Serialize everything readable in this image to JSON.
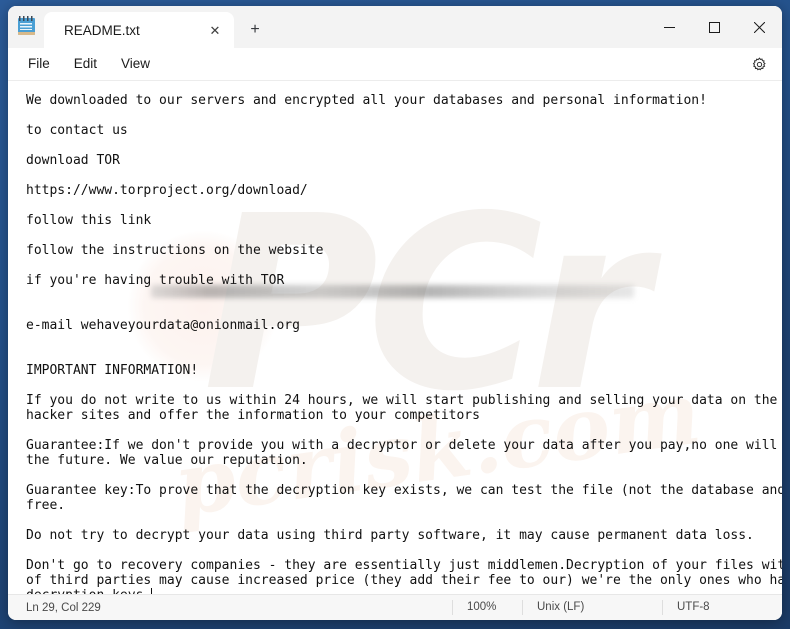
{
  "window": {
    "app_icon": "notepad-icon",
    "controls": {
      "minimize": "minimize-icon",
      "maximize": "maximize-icon",
      "close": "close-icon"
    }
  },
  "tabs": [
    {
      "title": "README.txt",
      "close_label": "✕",
      "active": true
    }
  ],
  "new_tab_label": "+",
  "menu": {
    "items": [
      "File",
      "Edit",
      "View"
    ],
    "settings_label": "settings-gear-icon"
  },
  "watermark": {
    "big": "PCr",
    "small": "pcrisk.com"
  },
  "editor": {
    "redacted_line_note": "blurred-url-redaction",
    "caret_visible": true,
    "lines": [
      "We downloaded to our servers and encrypted all your databases and personal information!",
      "",
      "to contact us",
      "",
      "download TOR",
      "",
      "https://www.torproject.org/download/",
      "",
      "follow this link ",
      "",
      "follow the instructions on the website",
      "",
      "if you're having trouble with TOR",
      "",
      "",
      "e-mail wehaveyourdata@onionmail.org",
      "",
      "",
      "IMPORTANT INFORMATION!",
      "",
      "If you do not write to us within 24 hours, we will start publishing and selling your data on the darknet on",
      "hacker sites and offer the information to your competitors",
      "",
      "Guarantee:If we don't provide you with a decryptor or delete your data after you pay,no one will pay us in",
      "the future. We value our reputation.",
      "",
      "Guarantee key:To prove that the decryption key exists, we can test the file (not the database and backup) for",
      "free.",
      "",
      "Do not try to decrypt your data using third party software, it may cause permanent data loss.",
      "",
      "Don't go to recovery companies - they are essentially just middlemen.Decryption of your files with the help",
      "of third parties may cause increased price (they add their fee to our) we're the only ones who have the",
      "decryption keys."
    ]
  },
  "statusbar": {
    "position": "Ln 29, Col 229",
    "zoom": "100%",
    "line_ending": "Unix (LF)",
    "encoding": "UTF-8"
  },
  "colors": {
    "desktop": "#24528c",
    "window_bg": "#ffffff",
    "titlebar_bg": "#f3f3f3",
    "statusbar_bg": "#f7f7f7",
    "text": "#111111",
    "close_hover": "#c42b1c"
  }
}
